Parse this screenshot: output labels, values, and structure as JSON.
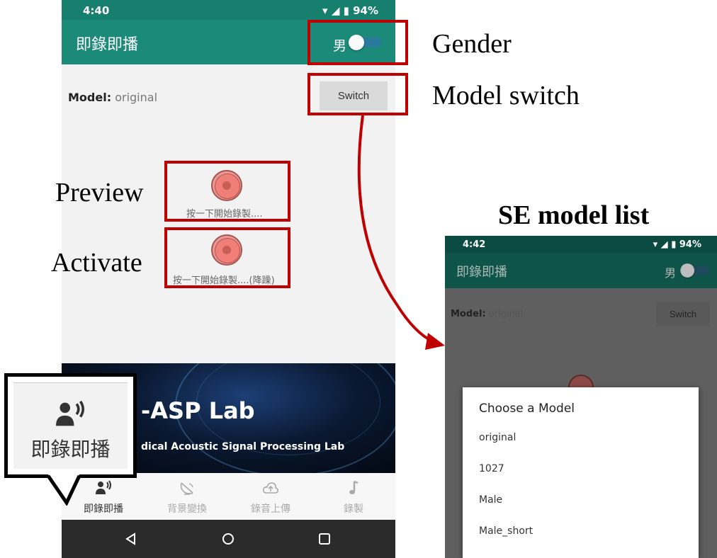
{
  "annotations": {
    "gender": "Gender",
    "model_switch": "Model switch",
    "preview": "Preview",
    "activate": "Activate",
    "se_model_list": "SE model list"
  },
  "left_phone": {
    "status": {
      "time": "4:40",
      "battery": "94%"
    },
    "app_title": "即錄即播",
    "gender_toggle": {
      "label": "男",
      "on": true
    },
    "model": {
      "label": "Model:",
      "value": "original"
    },
    "switch_label": "Switch",
    "preview_caption": "按一下開始錄製....",
    "activate_caption": "按一下開始錄製....(降躁)",
    "banner": {
      "title": "-ASP Lab",
      "subtitle": "dical Acoustic Signal Processing Lab"
    },
    "nav": [
      {
        "label": "即錄即播",
        "icon": "speaking-person-icon",
        "active": true
      },
      {
        "label": "背景變換",
        "icon": "satellite-dish-icon",
        "active": false
      },
      {
        "label": "錄音上傳",
        "icon": "cloud-upload-icon",
        "active": false
      },
      {
        "label": "錄製",
        "icon": "music-note-icon",
        "active": false
      }
    ]
  },
  "callout": {
    "label": "即錄即播",
    "icon": "speaking-person-icon"
  },
  "right_phone": {
    "status": {
      "time": "4:42",
      "battery": "94%"
    },
    "app_title": "即錄即播",
    "gender_toggle": {
      "label": "男"
    },
    "model": {
      "label": "Model:",
      "value": "original"
    },
    "switch_label": "Switch",
    "dialog": {
      "title": "Choose a Model",
      "options": [
        "original",
        "1027",
        "Male",
        "Male_short"
      ]
    }
  },
  "colors": {
    "teal": "#1b8a78",
    "highlight_red": "#c00000",
    "record_red": "#f07e79"
  }
}
